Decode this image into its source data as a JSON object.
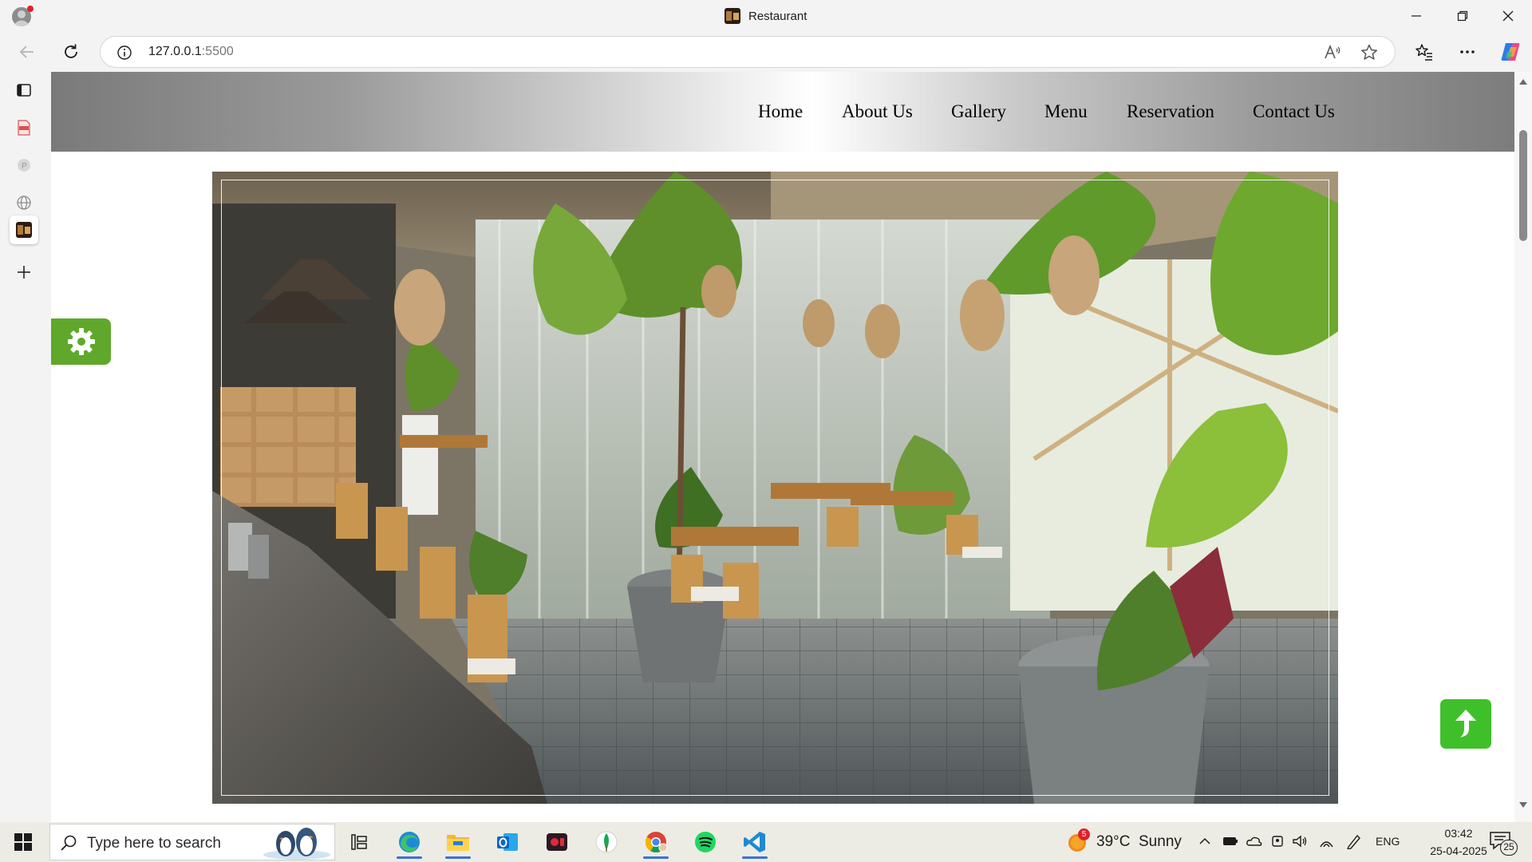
{
  "browser": {
    "tab_title": "Restaurant",
    "url_host": "127.0.0.1",
    "url_port": ":5500"
  },
  "site": {
    "nav": [
      "Home",
      "About Us",
      "Gallery",
      "Menu",
      "Reservation",
      "Contact Us"
    ],
    "accent_green": "#5fa82b",
    "totop_green": "#3fc02a"
  },
  "taskbar": {
    "search_placeholder": "Type here to search",
    "weather_badge": "5",
    "weather_text": "39°C  Sunny",
    "language": "ENG",
    "time": "03:42",
    "date": "25-04-2025",
    "notification_count": "25",
    "apps": [
      "task-view-icon",
      "edge-icon",
      "file-explorer-icon",
      "outlook-icon",
      "screen-recorder-icon",
      "mongodb-compass-icon",
      "chrome-icon",
      "spotify-icon",
      "vscode-icon"
    ]
  }
}
